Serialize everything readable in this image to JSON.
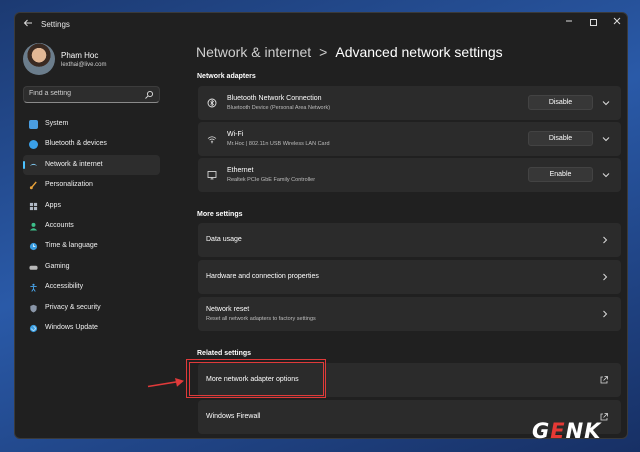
{
  "window": {
    "title": "Settings"
  },
  "user": {
    "name": "Pham Hoc",
    "email": "lexthai@live.com"
  },
  "search": {
    "placeholder": "Find a setting"
  },
  "nav": [
    {
      "label": "System",
      "icon": "system-icon",
      "color": "#4a9de0",
      "active": false
    },
    {
      "label": "Bluetooth & devices",
      "icon": "bluetooth-icon",
      "color": "#3aa0e8",
      "active": false
    },
    {
      "label": "Network & internet",
      "icon": "wifi-icon",
      "color": "#7fc8f0",
      "active": true
    },
    {
      "label": "Personalization",
      "icon": "brush-icon",
      "color": "#e8a23a",
      "active": false
    },
    {
      "label": "Apps",
      "icon": "apps-icon",
      "color": "#b0b8c4",
      "active": false
    },
    {
      "label": "Accounts",
      "icon": "accounts-icon",
      "color": "#3cbf8a",
      "active": false
    },
    {
      "label": "Time & language",
      "icon": "globe-clock-icon",
      "color": "#3a9de0",
      "active": false
    },
    {
      "label": "Gaming",
      "icon": "gaming-icon",
      "color": "#b8b8b8",
      "active": false
    },
    {
      "label": "Accessibility",
      "icon": "accessibility-icon",
      "color": "#4aa8f0",
      "active": false
    },
    {
      "label": "Privacy & security",
      "icon": "shield-icon",
      "color": "#8a96a8",
      "active": false
    },
    {
      "label": "Windows Update",
      "icon": "update-icon",
      "color": "#3a9de0",
      "active": false
    }
  ],
  "breadcrumb": {
    "parent": "Network & internet",
    "separator": ">",
    "current": "Advanced network settings"
  },
  "sections": {
    "adapters_title": "Network adapters",
    "more_title": "More settings",
    "related_title": "Related settings"
  },
  "adapters": [
    {
      "name": "Bluetooth Network Connection",
      "desc": "Bluetooth Device (Personal Area Network)",
      "button": "Disable",
      "icon": "bluetooth-network-icon"
    },
    {
      "name": "Wi-Fi",
      "desc": "Mr.Hoc | 802.11n USB Wireless LAN Card",
      "button": "Disable",
      "icon": "wifi-icon"
    },
    {
      "name": "Ethernet",
      "desc": "Realtek PCIe GbE Family Controller",
      "button": "Enable",
      "icon": "ethernet-icon"
    }
  ],
  "more_settings": [
    {
      "title": "Data usage",
      "desc": ""
    },
    {
      "title": "Hardware and connection properties",
      "desc": ""
    },
    {
      "title": "Network reset",
      "desc": "Reset all network adapters to factory settings"
    }
  ],
  "related_settings": [
    {
      "title": "More network adapter options"
    },
    {
      "title": "Windows Firewall"
    }
  ],
  "watermark": {
    "text": "GENK"
  },
  "colors": {
    "accent": "#4cc2ff",
    "highlight": "#e03a3a"
  }
}
